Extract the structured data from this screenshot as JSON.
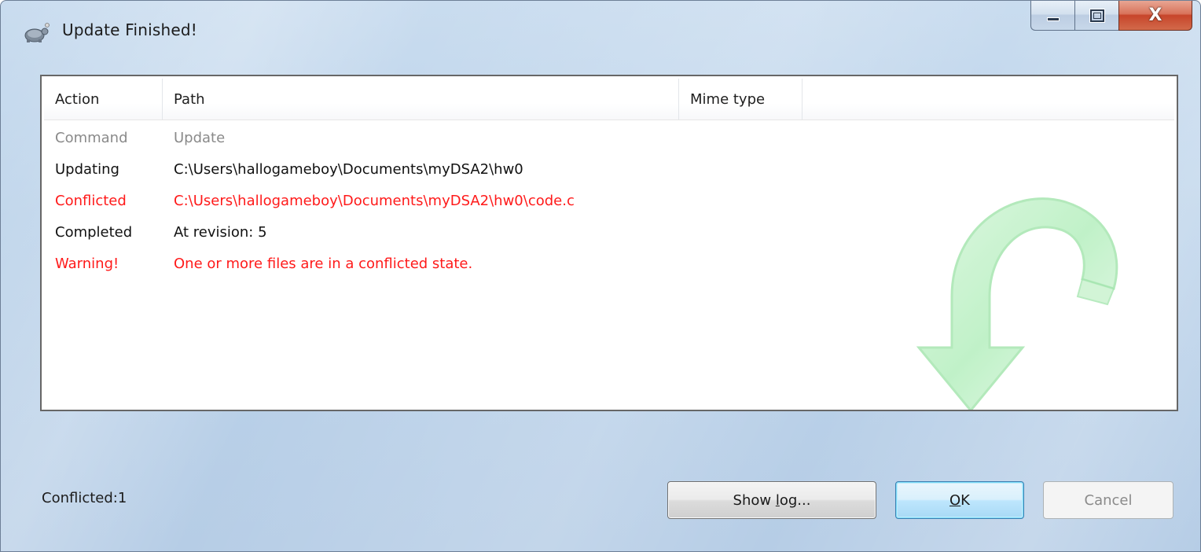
{
  "window": {
    "title": "Update Finished!",
    "minimize_label": "",
    "maximize_label": "",
    "close_glyph": "X"
  },
  "list": {
    "columns": [
      "Action",
      "Path",
      "Mime type"
    ],
    "rows": [
      {
        "action": "Command",
        "path": "Update",
        "style": "command"
      },
      {
        "action": "Updating",
        "path": "C:\\Users\\hallogameboy\\Documents\\myDSA2\\hw0",
        "style": "normal"
      },
      {
        "action": "Conflicted",
        "path": "C:\\Users\\hallogameboy\\Documents\\myDSA2\\hw0\\code.c",
        "style": "conflict"
      },
      {
        "action": "Completed",
        "path": "At revision: 5",
        "style": "normal"
      },
      {
        "action": "Warning!",
        "path": "One or more files are in a conflicted state.",
        "style": "conflict"
      }
    ]
  },
  "status": {
    "text": "Conflicted:1"
  },
  "buttons": {
    "show_log_prefix": "Show ",
    "show_log_accel": "l",
    "show_log_suffix": "og...",
    "ok_accel": "O",
    "ok_suffix": "K",
    "cancel": "Cancel"
  },
  "icons": {
    "app": "tortoise-icon",
    "watermark": "update-arrow-icon"
  },
  "colors": {
    "conflict": "#ff1a1a",
    "command": "#8a8a8a",
    "watermark": "#7ee08a"
  }
}
